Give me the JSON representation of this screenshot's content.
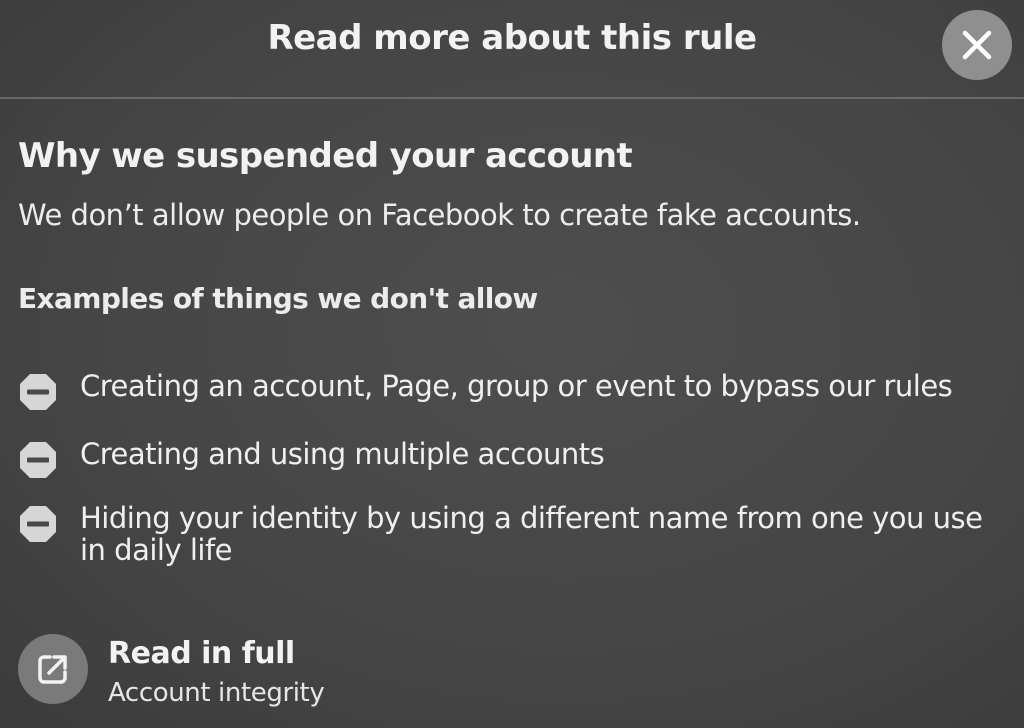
{
  "dialog": {
    "title": "Read more about this rule",
    "close_icon": "close-icon"
  },
  "reason": {
    "heading": "Why we suspended your account",
    "description": "We don’t allow people on Facebook to create fake accounts."
  },
  "examples": {
    "heading": "Examples of things we don't allow",
    "icon": "minus-octagon-icon",
    "items": [
      {
        "label": "Creating an account, Page, group or event to bypass our rules"
      },
      {
        "label": "Creating and using multiple accounts"
      },
      {
        "label": "Hiding your identity by using a different name from one you use in daily life"
      }
    ]
  },
  "read_full": {
    "title": "Read in full",
    "subtitle": "Account integrity",
    "icon": "external-link-icon"
  },
  "colors": {
    "background": "#484848",
    "close_button_bg": "#8f8f8f",
    "link_icon_bg": "#7a7a7a",
    "icon_fill": "#d6d6d6",
    "text": "#f0f0f0"
  }
}
